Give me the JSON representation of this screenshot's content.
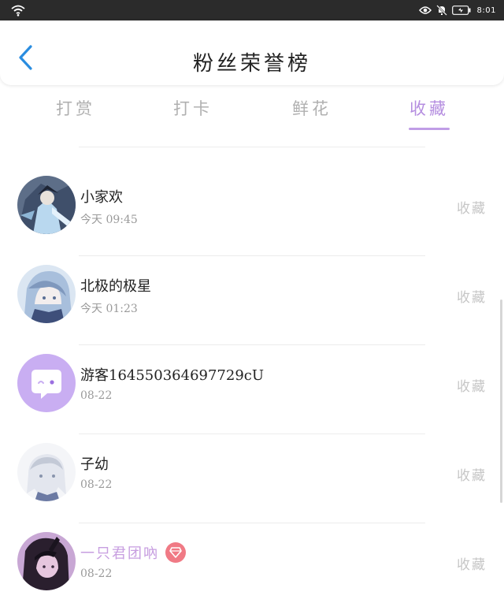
{
  "status_bar": {
    "time": "8:01"
  },
  "header": {
    "title": "粉丝荣誉榜"
  },
  "tabs": [
    {
      "label": "打赏"
    },
    {
      "label": "打卡"
    },
    {
      "label": "鲜花"
    },
    {
      "label": "收藏"
    }
  ],
  "active_tab": "收藏",
  "colors": {
    "accent": "#b58ee0",
    "badge": "#f07a85",
    "back_arrow": "#2a8de0"
  },
  "items": [
    {
      "name": "小家欢",
      "time": "今天 09:45",
      "action": "收藏",
      "avatar": "anime-warrior-blue-icon"
    },
    {
      "name": "北极的极星",
      "time": "今天 01:23",
      "action": "收藏",
      "avatar": "anime-girl-blue-hair-icon"
    },
    {
      "name": "游客1645503646977​29cU",
      "time": "08-22",
      "action": "收藏",
      "avatar": "chat-bubble-icon"
    },
    {
      "name": "子幼",
      "time": "08-22",
      "action": "收藏",
      "avatar": "sketch-girl-icon"
    },
    {
      "name": "一只君团吶",
      "time": "08-22",
      "action": "收藏",
      "avatar": "dark-anime-girl-icon",
      "vip": true
    }
  ]
}
